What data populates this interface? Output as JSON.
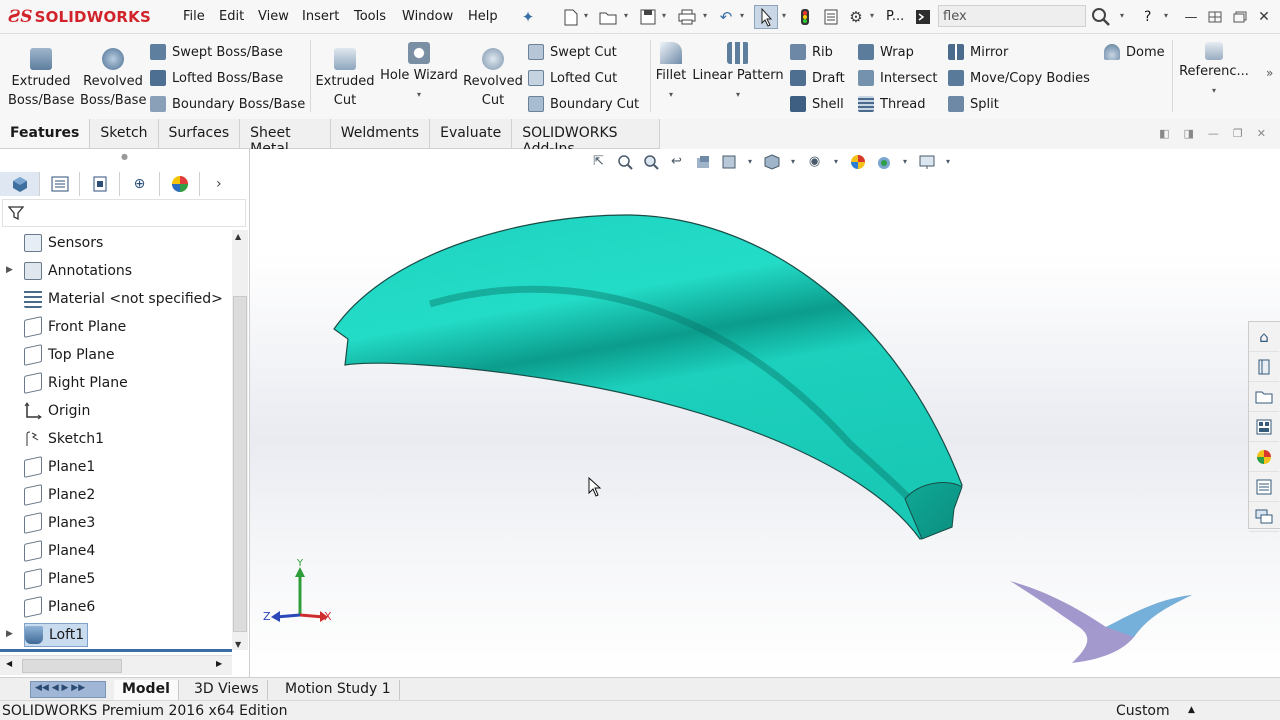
{
  "app": {
    "logo_ds": "ƧS",
    "logo_word": "SOLIDWORKS",
    "menu": [
      "File",
      "Edit",
      "View",
      "Insert",
      "Tools",
      "Window",
      "Help"
    ],
    "pin_label": "P...",
    "search_value": "flex",
    "help_label": "?"
  },
  "commands": {
    "extruded_boss": "Extruded Boss/Base",
    "revolved_boss": "Revolved Boss/Base",
    "swept_boss": "Swept Boss/Base",
    "lofted_boss": "Lofted Boss/Base",
    "boundary_boss": "Boundary Boss/Base",
    "extruded_cut": "Extruded Cut",
    "hole_wizard": "Hole Wizard",
    "revolved_cut": "Revolved Cut",
    "swept_cut": "Swept Cut",
    "lofted_cut": "Lofted Cut",
    "boundary_cut": "Boundary Cut",
    "fillet": "Fillet",
    "linear_pattern": "Linear Pattern",
    "rib": "Rib",
    "draft": "Draft",
    "shell": "Shell",
    "wrap": "Wrap",
    "intersect": "Intersect",
    "thread": "Thread",
    "mirror": "Mirror",
    "move_copy": "Move/Copy Bodies",
    "split": "Split",
    "dome": "Dome",
    "reference": "Referenc..."
  },
  "tabs": [
    "Features",
    "Sketch",
    "Surfaces",
    "Sheet Metal",
    "Weldments",
    "Evaluate",
    "SOLIDWORKS Add-Ins"
  ],
  "tree": {
    "items": [
      {
        "label": "Sensors",
        "icon": "sensors-icon"
      },
      {
        "label": "Annotations",
        "icon": "annotations-icon"
      },
      {
        "label": "Material <not specified>",
        "icon": "material-icon"
      },
      {
        "label": "Front Plane",
        "icon": "plane-icon"
      },
      {
        "label": "Top Plane",
        "icon": "plane-icon"
      },
      {
        "label": "Right Plane",
        "icon": "plane-icon"
      },
      {
        "label": "Origin",
        "icon": "origin-icon"
      },
      {
        "label": "Sketch1",
        "icon": "sketch-icon"
      },
      {
        "label": "Plane1",
        "icon": "plane-icon"
      },
      {
        "label": "Plane2",
        "icon": "plane-icon"
      },
      {
        "label": "Plane3",
        "icon": "plane-icon"
      },
      {
        "label": "Plane4",
        "icon": "plane-icon"
      },
      {
        "label": "Plane5",
        "icon": "plane-icon"
      },
      {
        "label": "Plane6",
        "icon": "plane-icon"
      },
      {
        "label": "Loft1",
        "icon": "loft-icon"
      }
    ]
  },
  "triad": {
    "x": "X",
    "y": "Y",
    "z": "Z"
  },
  "bottom_tabs": [
    "Model",
    "3D Views",
    "Motion Study 1"
  ],
  "status": {
    "edition": "SOLIDWORKS Premium 2016 x64 Edition",
    "units": "Custom"
  },
  "colors": {
    "part": "#19d6c2",
    "logo_red": "#d1232a",
    "selection": "#c9dbef"
  }
}
